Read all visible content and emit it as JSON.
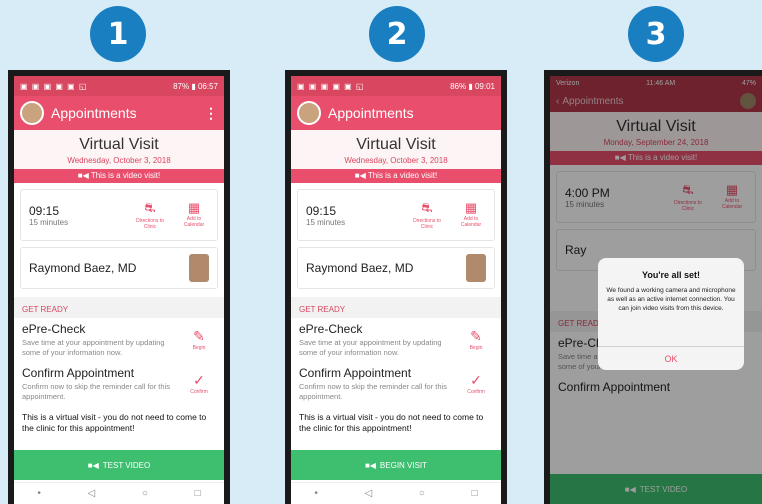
{
  "steps": [
    "1",
    "2",
    "3"
  ],
  "android_status": {
    "icons": "▣ ▣ ▣ ▣ ▣ ◱",
    "right1": "87% ▮ 06:57",
    "right2": "86% ▮ 09:01"
  },
  "app": {
    "title": "Appointments",
    "menu": "⋮"
  },
  "visit": {
    "title": "Virtual Visit",
    "date_android": "Wednesday, October 3, 2018",
    "date_ios": "Monday, September 24, 2018",
    "banner": "This is a video visit!"
  },
  "appointment": {
    "time_android": "09:15",
    "time_ios": "4:00 PM",
    "duration": "15 minutes",
    "action_directions": "Directions to Clinic",
    "action_calendar": "Add to Calendar"
  },
  "doctor": {
    "name": "Raymond Baez, MD",
    "name_short": "Ray"
  },
  "section": {
    "get_ready": "GET READY"
  },
  "tasks": {
    "precheck_title": "ePre-Check",
    "precheck_desc": "Save time at your appointment by updating some of your information now.",
    "precheck_action": "Begin",
    "confirm_title": "Confirm Appointment",
    "confirm_desc": "Confirm now to skip the reminder call for this appointment.",
    "confirm_action": "Confirm"
  },
  "note": "This is a virtual visit - you do not need to come to the clinic for this appointment!",
  "buttons": {
    "test_video": "TEST VIDEO",
    "begin_visit": "BEGIN VISIT"
  },
  "android_nav": {
    "back": "◁",
    "home": "○",
    "recent": "□",
    "dot": "•"
  },
  "ios": {
    "carrier": "Verizon",
    "time": "11:46 AM",
    "battery": "47%",
    "back": "Appointments"
  },
  "dialog": {
    "title": "You're all set!",
    "message": "We found a working camera and microphone as well as an active internet connection. You can join video visits from this device.",
    "ok": "OK"
  }
}
